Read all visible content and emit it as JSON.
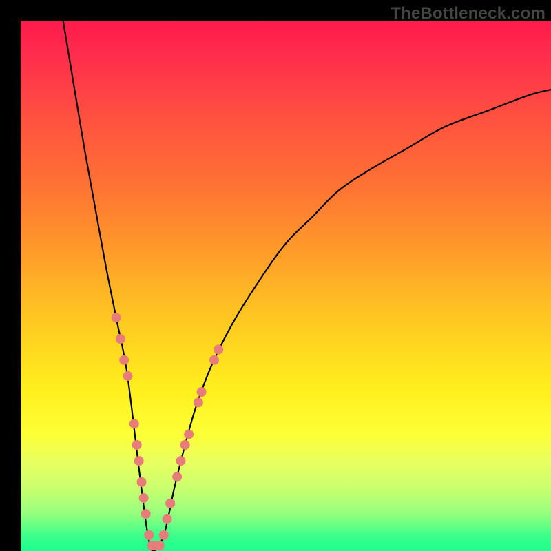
{
  "watermark": "TheBottleneck.com",
  "colors": {
    "frame_bg": "#000000",
    "curve": "#000000",
    "markers": "#e77c7a",
    "gradient_stops": [
      "#ff1a4d",
      "#ff314b",
      "#ff5040",
      "#ff6f35",
      "#ff8f2c",
      "#ffb225",
      "#ffd31f",
      "#fff01e",
      "#fcff36",
      "#eaff5e",
      "#cbff6e",
      "#95ff7e",
      "#3fff8a",
      "#1bff8f"
    ]
  },
  "chart_data": {
    "type": "line",
    "title": "",
    "xlabel": "",
    "ylabel": "",
    "xlim": [
      0,
      100
    ],
    "ylim": [
      0,
      100
    ],
    "grid": false,
    "legend": false,
    "series": [
      {
        "name": "bottleneck-curve",
        "x": [
          8,
          10,
          12,
          14,
          16,
          18,
          20,
          22,
          23,
          24,
          25,
          27,
          29,
          31,
          33,
          36,
          40,
          45,
          50,
          55,
          60,
          66,
          73,
          80,
          88,
          96,
          100
        ],
        "values": [
          100,
          88,
          76,
          65,
          54,
          44,
          34,
          18,
          10,
          3,
          0,
          3,
          12,
          20,
          27,
          35,
          43,
          51,
          58,
          63,
          68,
          72,
          76,
          80,
          83,
          86,
          87
        ]
      }
    ],
    "markers": [
      {
        "x": 18.0,
        "y": 44
      },
      {
        "x": 18.8,
        "y": 40
      },
      {
        "x": 19.5,
        "y": 36
      },
      {
        "x": 20.2,
        "y": 33
      },
      {
        "x": 21.4,
        "y": 24
      },
      {
        "x": 21.9,
        "y": 20
      },
      {
        "x": 22.3,
        "y": 17
      },
      {
        "x": 22.8,
        "y": 13
      },
      {
        "x": 23.2,
        "y": 10
      },
      {
        "x": 23.6,
        "y": 7
      },
      {
        "x": 24.2,
        "y": 3
      },
      {
        "x": 24.8,
        "y": 1
      },
      {
        "x": 25.5,
        "y": 1
      },
      {
        "x": 26.2,
        "y": 1
      },
      {
        "x": 27.0,
        "y": 3
      },
      {
        "x": 27.6,
        "y": 6
      },
      {
        "x": 28.2,
        "y": 9
      },
      {
        "x": 29.5,
        "y": 14
      },
      {
        "x": 30.2,
        "y": 17
      },
      {
        "x": 31.0,
        "y": 20
      },
      {
        "x": 31.7,
        "y": 22
      },
      {
        "x": 33.5,
        "y": 28
      },
      {
        "x": 34.1,
        "y": 30
      },
      {
        "x": 36.5,
        "y": 36
      },
      {
        "x": 37.3,
        "y": 38
      }
    ],
    "marker_radius_px": 7
  }
}
